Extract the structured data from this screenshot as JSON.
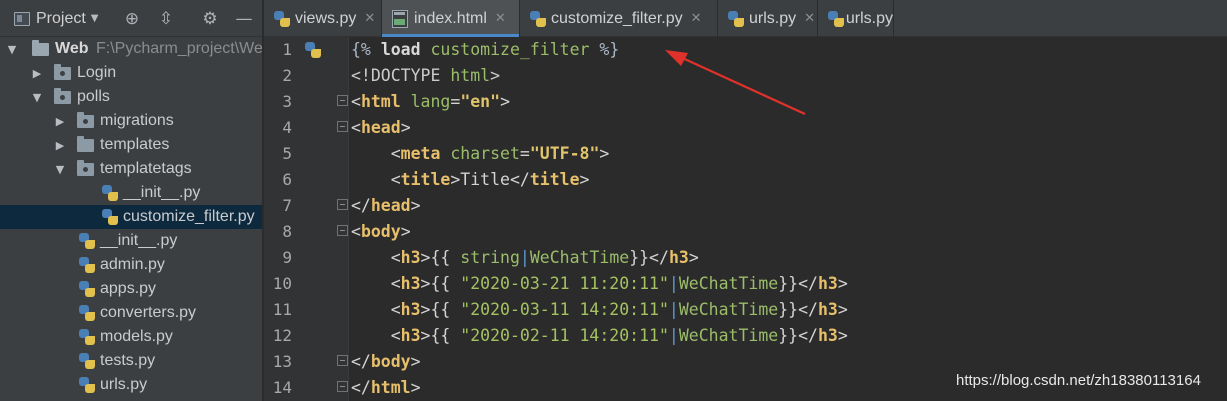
{
  "project_panel": {
    "title": "Project",
    "tree": [
      {
        "label": "Web",
        "path": "F:\\Pycharm_project\\We",
        "kind": "root"
      },
      {
        "label": "Login",
        "kind": "folder"
      },
      {
        "label": "polls",
        "kind": "folder"
      },
      {
        "label": "migrations",
        "kind": "folder"
      },
      {
        "label": "templates",
        "kind": "folder"
      },
      {
        "label": "templatetags",
        "kind": "folder"
      },
      {
        "label": "__init__.py",
        "kind": "file"
      },
      {
        "label": "customize_filter.py",
        "kind": "file",
        "selected": true
      },
      {
        "label": "__init__.py",
        "kind": "file"
      },
      {
        "label": "admin.py",
        "kind": "file"
      },
      {
        "label": "apps.py",
        "kind": "file"
      },
      {
        "label": "converters.py",
        "kind": "file"
      },
      {
        "label": "models.py",
        "kind": "file"
      },
      {
        "label": "tests.py",
        "kind": "file"
      },
      {
        "label": "urls.py",
        "kind": "file"
      }
    ]
  },
  "tabs": [
    {
      "label": "views.py",
      "icon": "python-file-icon",
      "closable": true
    },
    {
      "label": "index.html",
      "icon": "html-file-icon",
      "closable": true,
      "active": true
    },
    {
      "label": "customize_filter.py",
      "icon": "python-file-icon",
      "closable": true
    },
    {
      "label": "urls.py",
      "icon": "python-file-icon",
      "closable": true
    },
    {
      "label": "urls.py",
      "icon": "python-file-icon",
      "closable": false
    }
  ],
  "editor": {
    "line_numbers": [
      "1",
      "2",
      "3",
      "4",
      "5",
      "6",
      "7",
      "8",
      "9",
      "10",
      "11",
      "12",
      "13",
      "14"
    ],
    "lines": {
      "l1": [
        "{% ",
        "load",
        " ",
        "customize_filter",
        " %}"
      ],
      "l2": [
        "<!DOCTYPE ",
        "html",
        ">"
      ],
      "l3": [
        "<",
        "html",
        " ",
        "lang",
        "=",
        "\"en\"",
        ">"
      ],
      "l4": [
        "<",
        "head",
        ">"
      ],
      "l5": [
        "    <",
        "meta",
        " ",
        "charset",
        "=",
        "\"UTF-8\"",
        ">"
      ],
      "l6": [
        "    <",
        "title",
        ">",
        "Title",
        "</",
        "title",
        ">"
      ],
      "l7": [
        "</",
        "head",
        ">"
      ],
      "l8": [
        "<",
        "body",
        ">"
      ],
      "l9": [
        "    <",
        "h3",
        ">{{ ",
        "string",
        "|",
        "WeChatTime",
        "}}</",
        "h3",
        ">"
      ],
      "l10": [
        "    <",
        "h3",
        ">{{ ",
        "\"2020-03-21 11:20:11\"",
        "|",
        "WeChatTime",
        "}}</",
        "h3",
        ">"
      ],
      "l11": [
        "    <",
        "h3",
        ">{{ ",
        "\"2020-03-11 14:20:11\"",
        "|",
        "WeChatTime",
        "}}</",
        "h3",
        ">"
      ],
      "l12": [
        "    <",
        "h3",
        ">{{ ",
        "\"2020-02-11 14:20:11\"",
        "|",
        "WeChatTime",
        "}}</",
        "h3",
        ">"
      ],
      "l13": [
        "</",
        "body",
        ">"
      ],
      "l14": [
        "</",
        "html",
        ">"
      ]
    }
  },
  "watermark": "https://blog.csdn.net/zh18380113164",
  "colors": {
    "annotation_arrow": "#e0322b",
    "tab_active_underline": "#4a88c7",
    "selection": "#0d293e"
  }
}
